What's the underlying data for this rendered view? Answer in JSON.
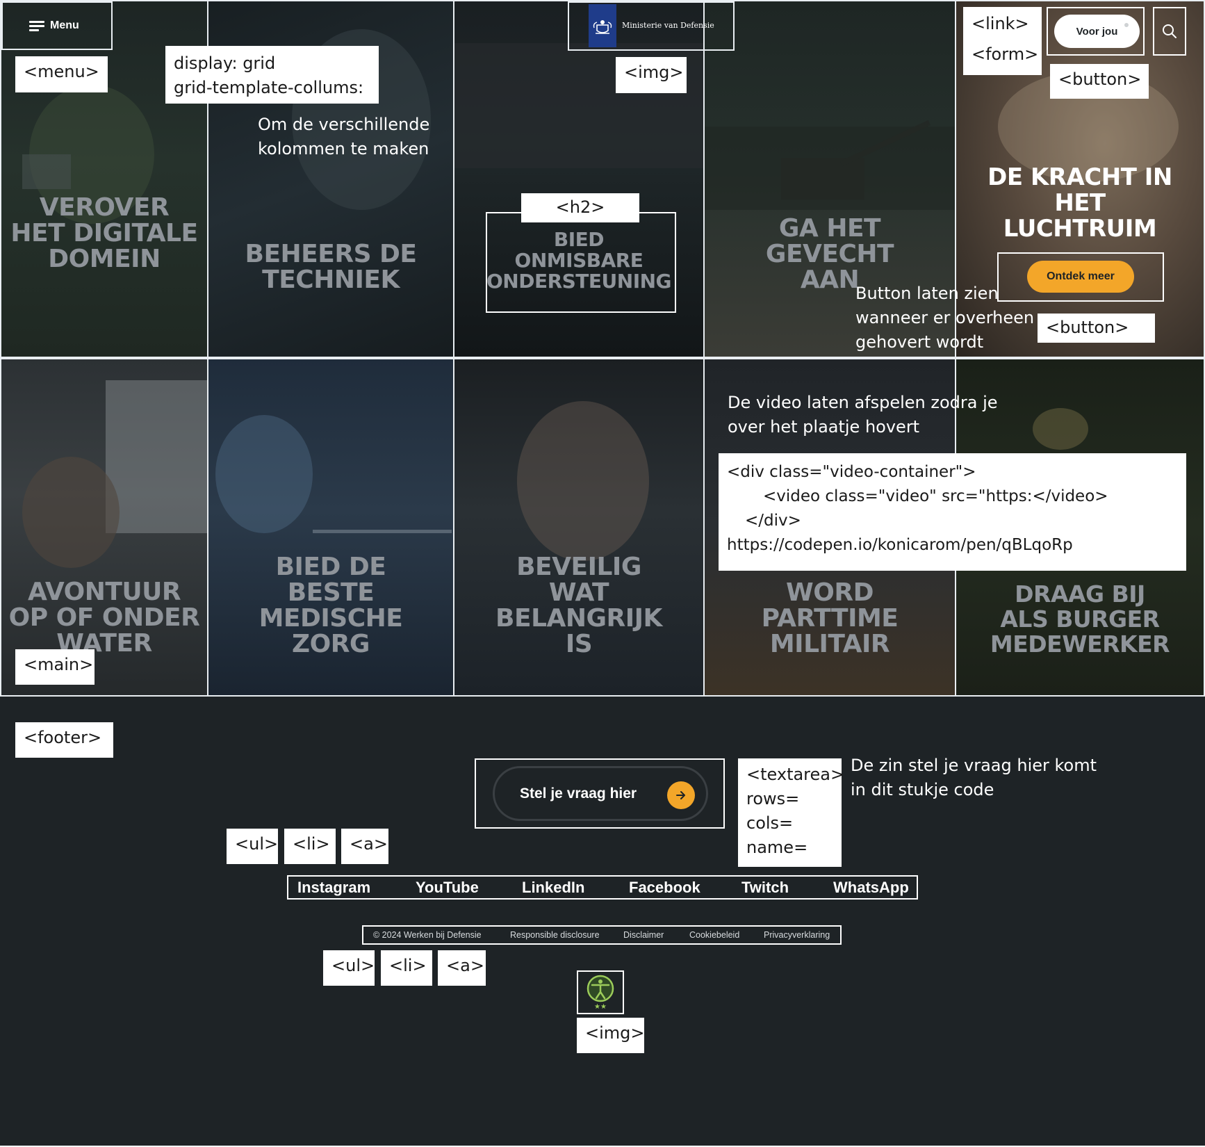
{
  "header": {
    "menu_label": "Menu",
    "logo_text": "Ministerie van Defensie",
    "voor_jou_label": "Voor jou",
    "search_icon": "search-icon"
  },
  "tiles": [
    {
      "title_lines": [
        "VEROVER",
        "HET DIGITALE",
        "DOMEIN"
      ]
    },
    {
      "title_lines": [
        "BEHEERS DE",
        "TECHNIEK"
      ]
    },
    {
      "title_lines": [
        "BIED",
        "ONMISBARE",
        "ONDERSTEUNING"
      ]
    },
    {
      "title_lines": [
        "GA HET",
        "GEVECHT",
        "AAN"
      ]
    },
    {
      "title_lines": [
        "DE KRACHT IN",
        "HET",
        "LUCHTRUIM"
      ],
      "button_label": "Ontdek meer"
    },
    {
      "title_lines": [
        "AVONTUUR",
        "OP OF ONDER",
        "WATER"
      ]
    },
    {
      "title_lines": [
        "BIED DE",
        "BESTE",
        "MEDISCHE",
        "ZORG"
      ]
    },
    {
      "title_lines": [
        "BEVEILIG",
        "WAT",
        "BELANGRIJK",
        "IS"
      ]
    },
    {
      "title_lines": [
        "WORD",
        "PARTTIME",
        "MILITAIR"
      ]
    },
    {
      "title_lines": [
        "DRAAG BIJ",
        "ALS BURGER",
        "MEDEWERKER"
      ]
    }
  ],
  "annotations": {
    "menu": "<menu>",
    "grid_line1": "display: grid",
    "grid_line2": "grid-template-collums:",
    "grid_note_line1": "Om de verschillende",
    "grid_note_line2": "kolommen te maken",
    "img_top": "<img>",
    "h2": "<h2>",
    "link": "<link>",
    "form": "<form>",
    "button_top": "<button>",
    "button_hover": "<button>",
    "hover_note_line1": "Button laten zien",
    "hover_note_line2": "wanneer er overheen",
    "hover_note_line3": "gehovert wordt",
    "video_note_line1": "De video laten afspelen zodra je",
    "video_note_line2": "over het plaatje hovert",
    "video_code_line1": "<div class=\"video-container\">",
    "video_code_line2": "<video class=\"video\" src=\"https:</video>",
    "video_code_line3": "</div>",
    "video_code_line4": "https://codepen.io/konicarom/pen/qBLqoRp",
    "main": "<main>",
    "footer": "<footer>",
    "textarea_line1": "<textarea>",
    "textarea_line2": "rows=",
    "textarea_line3": "cols=",
    "textarea_line4": "name=",
    "textarea_note_line1": "De zin stel je vraag hier komt",
    "textarea_note_line2": "in dit stukje code",
    "ul1": "<ul>",
    "li1": "<li>",
    "a1": "<a>",
    "ul2": "<ul>",
    "li2": "<li>",
    "a2": "<a>",
    "img_bottom": "<img>"
  },
  "footer": {
    "ask_label": "Stel je vraag hier",
    "social_links": [
      "Instagram",
      "YouTube",
      "LinkedIn",
      "Facebook",
      "Twitch",
      "WhatsApp"
    ],
    "copyright": "© 2024 Werken bij Defensie",
    "legal_links": [
      "Responsible disclosure",
      "Disclaimer",
      "Cookiebeleid",
      "Privacyverklaring"
    ],
    "accessibility_icon": "accessibility-icon"
  },
  "colors": {
    "accent": "#f3a629",
    "footer_bg": "#1e2326",
    "tile_title": "#8f949a",
    "logo_blue": "#1f3c8a"
  }
}
